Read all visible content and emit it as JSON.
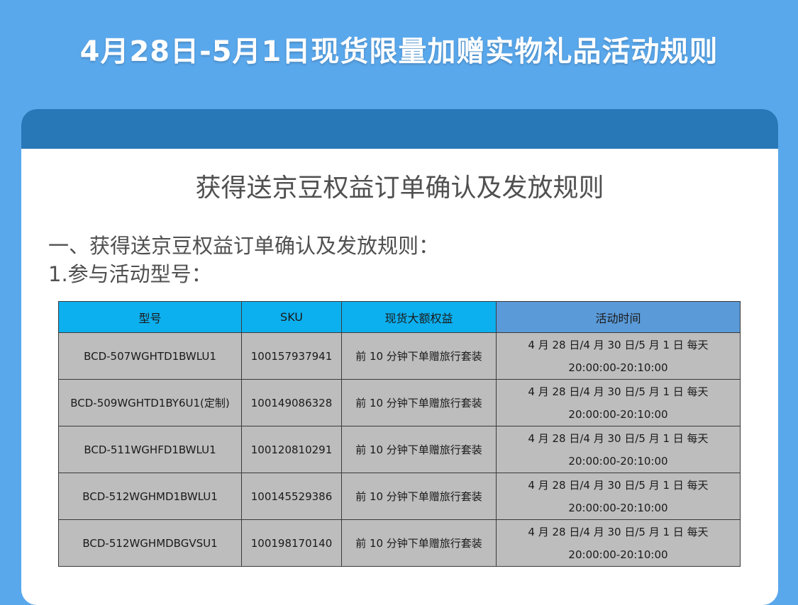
{
  "banner": {
    "title": "4月28日-5月1日现货限量加赠实物礼品活动规则"
  },
  "card": {
    "title": "获得送京豆权益订单确认及发放规则",
    "section_heading": "一、获得送京豆权益订单确认及发放规则：",
    "sub_heading": "1.参与活动型号："
  },
  "table": {
    "headers": [
      "型号",
      "SKU",
      "现货大额权益",
      "活动时间"
    ],
    "rows": [
      {
        "model": "BCD-507WGHTD1BWLU1",
        "sku": "100157937941",
        "benefit": "前 10 分钟下单赠旅行套装",
        "time": "4 月 28 日/4 月 30 日/5 月 1 日  每天 20:00:00-20:10:00"
      },
      {
        "model": "BCD-509WGHTD1BY6U1(定制)",
        "sku": "100149086328",
        "benefit": "前 10 分钟下单赠旅行套装",
        "time": "4 月 28 日/4 月 30 日/5 月 1 日  每天 20:00:00-20:10:00"
      },
      {
        "model": "BCD-511WGHFD1BWLU1",
        "sku": "100120810291",
        "benefit": "前 10 分钟下单赠旅行套装",
        "time": "4 月 28 日/4 月 30 日/5 月 1 日  每天 20:00:00-20:10:00"
      },
      {
        "model": "BCD-512WGHMD1BWLU1",
        "sku": "100145529386",
        "benefit": "前 10 分钟下单赠旅行套装",
        "time": "4 月 28 日/4 月 30 日/5 月 1 日  每天 20:00:00-20:10:00"
      },
      {
        "model": "BCD-512WGHMDBGVSU1",
        "sku": "100198170140",
        "benefit": "前 10 分钟下单赠旅行套装",
        "time": "4 月 28 日/4 月 30 日/5 月 1 日  每天 20:00:00-20:10:00"
      }
    ]
  },
  "colors": {
    "page_background": "#5aa8ec",
    "card_header": "#2878b8",
    "table_header": "#0db0ef",
    "table_header_time": "#5a9ad8",
    "table_cell": "#bdbdbd"
  }
}
